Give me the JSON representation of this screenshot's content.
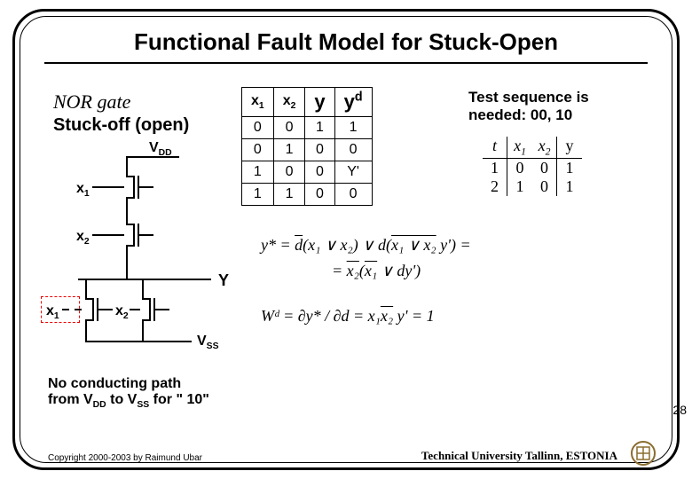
{
  "title": "Functional Fault Model for Stuck-Open",
  "gate_label": "NOR gate",
  "stuck_label": "Stuck-off (open)",
  "test_seq_line1": "Test sequence is",
  "test_seq_line2": "needed: 00, 10",
  "vdd": "V",
  "vdd_sub": "DD",
  "vss": "V",
  "vss_sub": "SS",
  "x1": "x",
  "x1_sub": "1",
  "x2": "x",
  "x2_sub": "2",
  "Y": "Y",
  "truth": {
    "headers": [
      "x1",
      "x2",
      "y",
      "yd"
    ],
    "rows": [
      [
        "0",
        "0",
        "1",
        "1"
      ],
      [
        "0",
        "1",
        "0",
        "0"
      ],
      [
        "1",
        "0",
        "0",
        "Y'"
      ],
      [
        "1",
        "1",
        "0",
        "0"
      ]
    ]
  },
  "seq_table": {
    "head": [
      "t",
      "x1",
      "x2",
      "y"
    ],
    "r1": [
      "1",
      "0",
      "0",
      "1"
    ],
    "r2": [
      "2",
      "1",
      "0",
      "1"
    ]
  },
  "equations": {
    "line1_a": "y* = ",
    "line1_b": "d",
    "line1_c": "(x₁ ∨ x₂) ∨ d(",
    "line1_d": "x₁ ∨ x₂",
    "line1_e": " y') =",
    "line2_a": "= ",
    "line2_b": "x₂",
    "line2_c": "(",
    "line2_d": "x₁",
    "line2_e": " ∨ dy')",
    "line3_a": "Wᵈ = ∂y* / ∂d = x₁",
    "line3_b": "x₂",
    "line3_c": " y' = 1"
  },
  "nopath_line1": "No conducting path",
  "nopath_line2_a": "from V",
  "nopath_line2_b": "DD",
  "nopath_line2_c": " to V",
  "nopath_line2_d": "SS",
  "nopath_line2_e": " for \" 10\"",
  "copyright": "Copyright 2000-2003 by Raimund Ubar",
  "university": "Technical University Tallinn, ESTONIA",
  "page_number": "28"
}
